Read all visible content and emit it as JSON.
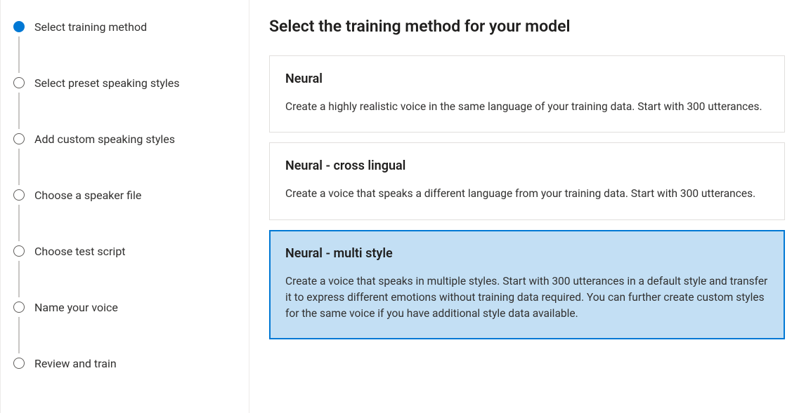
{
  "sidebar": {
    "steps": [
      {
        "label": "Select training method",
        "active": true
      },
      {
        "label": "Select preset speaking styles",
        "active": false
      },
      {
        "label": "Add custom speaking styles",
        "active": false
      },
      {
        "label": "Choose a speaker file",
        "active": false
      },
      {
        "label": "Choose test script",
        "active": false
      },
      {
        "label": "Name your voice",
        "active": false
      },
      {
        "label": "Review and train",
        "active": false
      }
    ]
  },
  "main": {
    "title": "Select the training method for your model",
    "options": [
      {
        "title": "Neural",
        "desc": "Create a highly realistic voice in the same language of your training data. Start with 300 utterances.",
        "selected": false
      },
      {
        "title": "Neural - cross lingual",
        "desc": "Create a voice that speaks a different language from your training data. Start with 300 utterances.",
        "selected": false
      },
      {
        "title": "Neural - multi style",
        "desc": "Create a voice that speaks in multiple styles. Start with 300 utterances in a default style and transfer it to express different emotions without training data required. You can further create custom styles for the same voice if you have additional style data available.",
        "selected": true
      }
    ]
  }
}
